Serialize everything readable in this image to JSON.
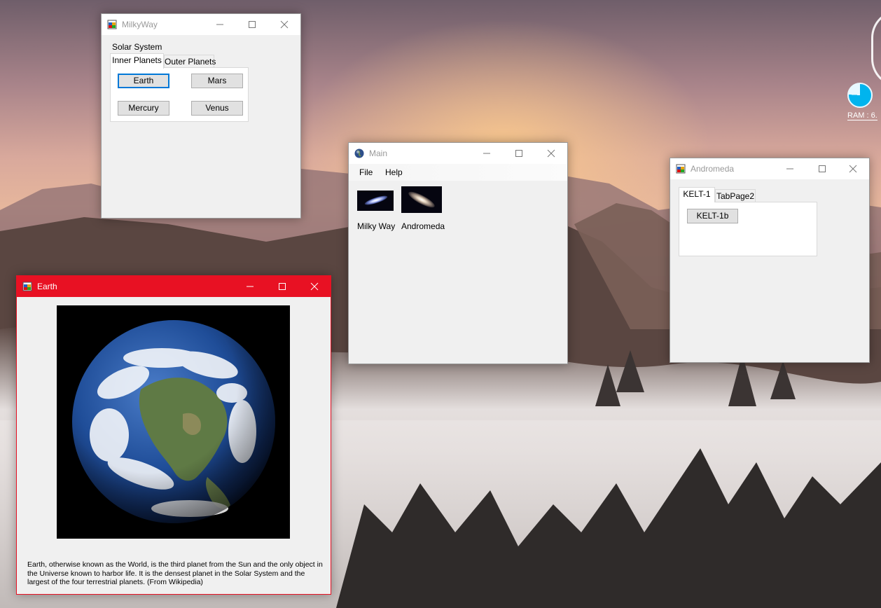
{
  "desktop": {
    "ram_label": "RAM : 6.",
    "ram_fraction": 0.76,
    "accent_color": "#00b4ee"
  },
  "milkyway_window": {
    "title": "MilkyWay",
    "group_label": "Solar System",
    "tabs": [
      "Inner Planets",
      "Outer Planets"
    ],
    "buttons": [
      "Earth",
      "Mars",
      "Mercury",
      "Venus"
    ]
  },
  "main_window": {
    "title": "Main",
    "menu": [
      "File",
      "Help"
    ],
    "gallery": [
      {
        "label": "Milky Way",
        "icon": "milky-way-galaxy-thumbnail"
      },
      {
        "label": "Andromeda",
        "icon": "andromeda-galaxy-thumbnail"
      }
    ]
  },
  "andromeda_window": {
    "title": "Andromeda",
    "tabs": [
      "KELT-1",
      "TabPage2"
    ],
    "button": "KELT-1b"
  },
  "earth_window": {
    "title": "Earth",
    "title_bar_color": "#e81123",
    "image": "earth-globe-image",
    "description": "Earth, otherwise known as the World, is the third planet from the Sun and the only object in the Universe known to harbor life. It is the densest planet in the Solar System and the largest of the four terrestrial planets. (From Wikipedia)"
  }
}
